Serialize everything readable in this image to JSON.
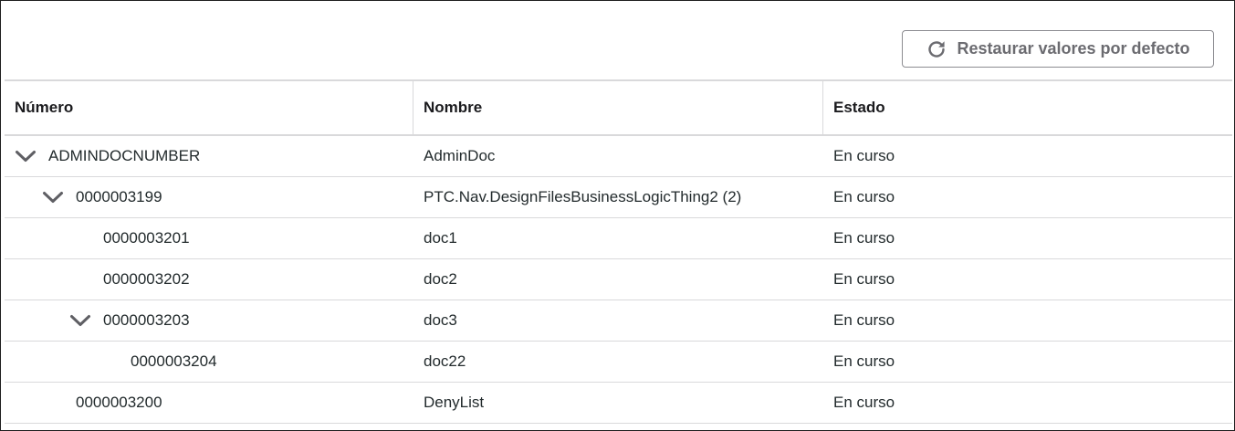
{
  "toolbar": {
    "reset_label": "Restaurar valores por defecto",
    "reset_icon": "refresh-icon"
  },
  "columns": {
    "number": "Número",
    "name": "Nombre",
    "status": "Estado"
  },
  "rows": [
    {
      "number": "ADMINDOCNUMBER",
      "name": "AdminDoc",
      "status": "En curso",
      "level": 0,
      "expandable": true,
      "expanded": true
    },
    {
      "number": "0000003199",
      "name": "PTC.Nav.DesignFilesBusinessLogicThing2 (2)",
      "status": "En curso",
      "level": 1,
      "expandable": true,
      "expanded": true
    },
    {
      "number": "0000003201",
      "name": "doc1",
      "status": "En curso",
      "level": 2,
      "expandable": false
    },
    {
      "number": "0000003202",
      "name": "doc2",
      "status": "En curso",
      "level": 2,
      "expandable": false
    },
    {
      "number": "0000003203",
      "name": "doc3",
      "status": "En curso",
      "level": 2,
      "expandable": true,
      "expanded": true
    },
    {
      "number": "0000003204",
      "name": "doc22",
      "status": "En curso",
      "level": 3,
      "expandable": false
    },
    {
      "number": "0000003200",
      "name": "DenyList",
      "status": "En curso",
      "level": 1,
      "expandable": false
    }
  ],
  "colors": {
    "border": "#d9d9db",
    "text": "#232b2d",
    "button_text": "#6b6b70",
    "chevron": "#5f5f64"
  }
}
